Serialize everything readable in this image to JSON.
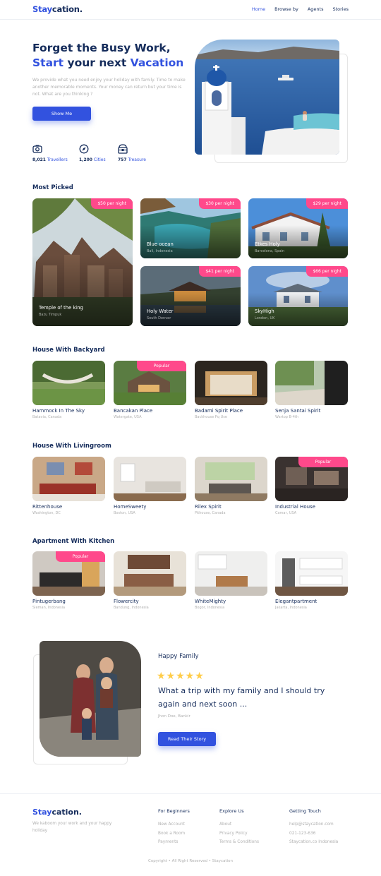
{
  "brand": {
    "part1": "Stay",
    "part2": "cation."
  },
  "nav": {
    "items": [
      "Home",
      "Browse by",
      "Agents",
      "Stories"
    ]
  },
  "hero": {
    "title_line1": "Forget the Busy Work,",
    "title_line2_blue1": "Start",
    "title_line2_mid": " your next ",
    "title_line2_blue2": "Vacation",
    "description": "We provide what you need enjoy your holiday with family. Time to make another memorable moments. Your money can return but your time is not. What are you thinking ?",
    "button": "Show Me",
    "stats": [
      {
        "icon": "camera-icon",
        "number": "8,021",
        "label": "Travellers"
      },
      {
        "icon": "compass-icon",
        "number": "1,200",
        "label": "Cities"
      },
      {
        "icon": "treasure-icon",
        "number": "757",
        "label": "Treasure"
      }
    ]
  },
  "most_picked": {
    "title": "Most Picked",
    "items": [
      {
        "price": "$50 per night",
        "name": "Temple of the king",
        "location": "Bazu Timpuk"
      },
      {
        "price": "$30 per night",
        "name": "Blue ocean",
        "location": "Bali, Indonesia"
      },
      {
        "price": "$29 per night",
        "name": "Etkes Holy",
        "location": "Barcelona, Spain"
      },
      {
        "price": "$41 per night",
        "name": "Holy Water",
        "location": "South Denver"
      },
      {
        "price": "$66 per night",
        "name": "SkyHigh",
        "location": "London, UK"
      }
    ]
  },
  "backyard": {
    "title": "House With Backyard",
    "items": [
      {
        "name": "Hammock In The Sky",
        "location": "Batavia, Canada",
        "badge": ""
      },
      {
        "name": "Bancakan Place",
        "location": "Watergate, USA",
        "badge": "Popular"
      },
      {
        "name": "Badami Spirit Place",
        "location": "Backhouse Pq Use",
        "badge": ""
      },
      {
        "name": "Senja Santai Spirit",
        "location": "Wartop B-4th",
        "badge": ""
      }
    ]
  },
  "livingroom": {
    "title": "House With Livingroom",
    "items": [
      {
        "name": "Rittenhouse",
        "location": "Washington, DC",
        "badge": ""
      },
      {
        "name": "HomeSweety",
        "location": "Boston, USA",
        "badge": ""
      },
      {
        "name": "Rilex Spirit",
        "location": "Pithouse, Canada",
        "badge": ""
      },
      {
        "name": "Industrial House",
        "location": "Camar, USA",
        "badge": "Popular"
      }
    ]
  },
  "kitchen": {
    "title": "Apartment With Kitchen",
    "items": [
      {
        "name": "Pintugerbang",
        "location": "Sleman, Indonesia",
        "badge": "Popular"
      },
      {
        "name": "Flowercity",
        "location": "Bandung, Indonesia",
        "badge": ""
      },
      {
        "name": "WhiteMighty",
        "location": "Bogor, Indonesia",
        "badge": ""
      },
      {
        "name": "Elegantpartment",
        "location": "Jakarta, Indonesia",
        "badge": ""
      }
    ]
  },
  "testimonial": {
    "title": "Happy Family",
    "stars": "★★★★★",
    "quote": "What a trip with my family and I should try again and next soon ...",
    "author": "Jhon Doe, Bankir",
    "button": "Read Their Story"
  },
  "footer": {
    "description": "We kaboom your work and your happy holiday",
    "columns": [
      {
        "heading": "For Beginners",
        "items": [
          "New Account",
          "Book a Room",
          "Payments"
        ]
      },
      {
        "heading": "Explore Us",
        "items": [
          "About",
          "Privacy Policy",
          "Terms & Conditions"
        ]
      },
      {
        "heading": "Getting Touch",
        "items": [
          "help@staycation.com",
          "021-123-636",
          "Staycation.co Indonesia"
        ]
      }
    ],
    "copyright": "Copyright • All Right Reserved • Staycation"
  },
  "colors": {
    "accent": "#3252df",
    "navy": "#152c5b",
    "pink": "#ff498b",
    "star": "#ffcc47"
  }
}
